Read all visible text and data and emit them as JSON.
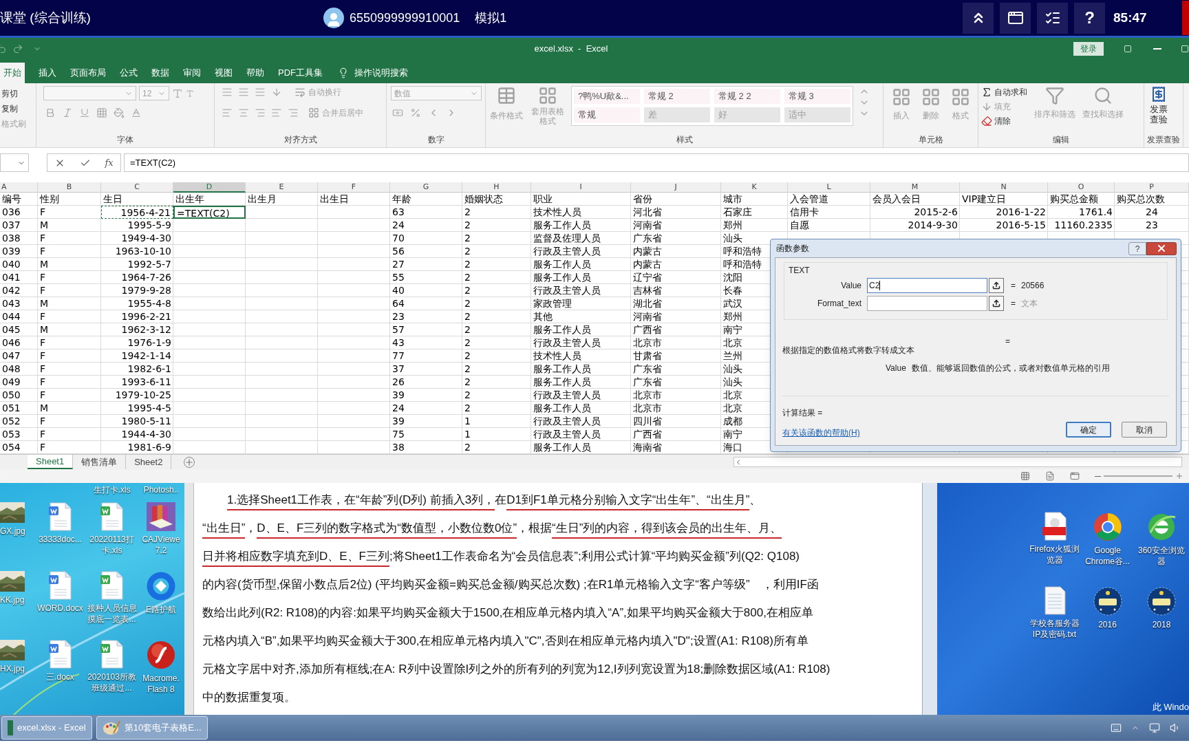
{
  "exam_bar": {
    "title": "课堂 (综合训练)",
    "user_id": "6550999999910001",
    "mode": "模拟1",
    "help": "?",
    "timer": "85:47"
  },
  "excel": {
    "title": "excel.xlsx  -  Excel",
    "login": "登录",
    "tabs": [
      {
        "label": "开始",
        "selected": true
      },
      {
        "label": "插入",
        "selected": false
      },
      {
        "label": "页面布局",
        "selected": false
      },
      {
        "label": "公式",
        "selected": false
      },
      {
        "label": "数据",
        "selected": false
      },
      {
        "label": "审阅",
        "selected": false
      },
      {
        "label": "视图",
        "selected": false
      },
      {
        "label": "帮助",
        "selected": false
      },
      {
        "label": "PDF工具集",
        "selected": false
      }
    ],
    "search_hint": "操作说明搜索",
    "ribbon": [
      {
        "kind": "clipboard",
        "items": [
          "剪切",
          "复制",
          "格式刷"
        ]
      },
      {
        "kind": "font",
        "label": "字体",
        "size": "12"
      },
      {
        "kind": "alignment",
        "label": "对齐方式",
        "wrap": "自动换行",
        "merge": "合并后居中"
      },
      {
        "kind": "number",
        "label": "数字",
        "format": "数值"
      },
      {
        "kind": "styles",
        "label": "样式",
        "conditional": "条件格式",
        "table_format": "套用表格格式",
        "styles": [
          "?鸭%U歃&...",
          "常规 2",
          "常规 2 2",
          "常规 3",
          "常规",
          "差",
          "好",
          "适中"
        ]
      },
      {
        "kind": "cells",
        "label": "单元格",
        "items": [
          "插入",
          "删除",
          "格式"
        ]
      },
      {
        "kind": "editing",
        "label": "编辑",
        "autosum": "自动求和",
        "fill": "填充",
        "clear": "清除",
        "sort": "排序和筛选",
        "find": "查找和选择"
      },
      {
        "kind": "invoice",
        "label": "发票查验",
        "button": "发票查验"
      }
    ],
    "formula_bar": {
      "fx": "fx",
      "formula": "=TEXT(C2)"
    },
    "columns": [
      {
        "letter": "A",
        "selected": false
      },
      {
        "letter": "B",
        "selected": false
      },
      {
        "letter": "C",
        "selected": false
      },
      {
        "letter": "D",
        "selected": true
      },
      {
        "letter": "E",
        "selected": false
      },
      {
        "letter": "F",
        "selected": false
      },
      {
        "letter": "G",
        "selected": false
      },
      {
        "letter": "H",
        "selected": false
      },
      {
        "letter": "I",
        "selected": false
      },
      {
        "letter": "J",
        "selected": false
      },
      {
        "letter": "K",
        "selected": false
      },
      {
        "letter": "L",
        "selected": false
      },
      {
        "letter": "M",
        "selected": false
      },
      {
        "letter": "N",
        "selected": false
      },
      {
        "letter": "O",
        "selected": false
      },
      {
        "letter": "P",
        "selected": false
      }
    ],
    "rows": [
      {
        "cells": {
          "A": "编号",
          "B": "性别",
          "C": "生日",
          "D": "出生年",
          "E": "出生月",
          "F": "出生日",
          "G": "年龄",
          "H": "婚姻状态",
          "I": "职业",
          "J": "省份",
          "K": "城市",
          "L": "入会管道",
          "M": "会员入会日",
          "N": "VIP建立日",
          "O": "购买总金额",
          "P": "购买总次数"
        }
      },
      {
        "cells": {
          "A": "036",
          "B": "F",
          "C": {
            "text": "1956-4-21",
            "referenced": true
          },
          "D": {
            "text": "=TEXT(C2)",
            "active": true
          },
          "G": "63",
          "H": "2",
          "I": "技术性人员",
          "J": "河北省",
          "K": "石家庄",
          "L": "信用卡",
          "M": "2015-2-6",
          "N": "2016-1-22",
          "O": "1761.4",
          "P": "24"
        }
      },
      {
        "cells": {
          "A": "037",
          "B": "M",
          "C": "1995-5-9",
          "G": "24",
          "H": "2",
          "I": "服务工作人员",
          "J": "河南省",
          "K": "郑州",
          "L": "自愿",
          "M": "2014-9-30",
          "N": "2016-5-15",
          "O": "11160.2335",
          "P": "23"
        }
      },
      {
        "cells": {
          "A": "038",
          "B": "F",
          "C": "1949-4-30",
          "G": "70",
          "H": "2",
          "I": "监督及佐理人员",
          "J": "广东省",
          "K": "汕头"
        }
      },
      {
        "cells": {
          "A": "039",
          "B": "F",
          "C": "1963-10-10",
          "G": "56",
          "H": "2",
          "I": "行政及主管人员",
          "J": "内蒙古",
          "K": "呼和浩特"
        }
      },
      {
        "cells": {
          "A": "040",
          "B": "M",
          "C": "1992-5-7",
          "G": "27",
          "H": "2",
          "I": "服务工作人员",
          "J": "内蒙古",
          "K": "呼和浩特"
        }
      },
      {
        "cells": {
          "A": "041",
          "B": "F",
          "C": "1964-7-26",
          "G": "55",
          "H": "2",
          "I": "服务工作人员",
          "J": "辽宁省",
          "K": "沈阳"
        }
      },
      {
        "cells": {
          "A": "042",
          "B": "F",
          "C": "1979-9-28",
          "G": "40",
          "H": "2",
          "I": "行政及主管人员",
          "J": "吉林省",
          "K": "长春"
        }
      },
      {
        "cells": {
          "A": "043",
          "B": "M",
          "C": "1955-4-8",
          "G": "64",
          "H": "2",
          "I": "家政管理",
          "J": "湖北省",
          "K": "武汉"
        }
      },
      {
        "cells": {
          "A": "044",
          "B": "F",
          "C": "1996-2-21",
          "G": "23",
          "H": "2",
          "I": "其他",
          "J": "河南省",
          "K": "郑州"
        }
      },
      {
        "cells": {
          "A": "045",
          "B": "M",
          "C": "1962-3-12",
          "G": "57",
          "H": "2",
          "I": "服务工作人员",
          "J": "广西省",
          "K": "南宁"
        }
      },
      {
        "cells": {
          "A": "046",
          "B": "F",
          "C": "1976-1-9",
          "G": "43",
          "H": "2",
          "I": "行政及主管人员",
          "J": "北京市",
          "K": "北京"
        }
      },
      {
        "cells": {
          "A": "047",
          "B": "F",
          "C": "1942-1-14",
          "G": "77",
          "H": "2",
          "I": "技术性人员",
          "J": "甘肃省",
          "K": "兰州"
        }
      },
      {
        "cells": {
          "A": "048",
          "B": "F",
          "C": "1982-6-1",
          "G": "37",
          "H": "2",
          "I": "服务工作人员",
          "J": "广东省",
          "K": "汕头"
        }
      },
      {
        "cells": {
          "A": "049",
          "B": "F",
          "C": "1993-6-11",
          "G": "26",
          "H": "2",
          "I": "服务工作人员",
          "J": "广东省",
          "K": "汕头"
        }
      },
      {
        "cells": {
          "A": "050",
          "B": "F",
          "C": "1979-10-25",
          "G": "39",
          "H": "2",
          "I": "行政及主管人员",
          "J": "北京市",
          "K": "北京"
        }
      },
      {
        "cells": {
          "A": "051",
          "B": "M",
          "C": "1995-4-5",
          "G": "24",
          "H": "2",
          "I": "服务工作人员",
          "J": "北京市",
          "K": "北京"
        }
      },
      {
        "cells": {
          "A": "052",
          "B": "F",
          "C": "1980-5-11",
          "G": "39",
          "H": "1",
          "I": "行政及主管人员",
          "J": "四川省",
          "K": "成都"
        }
      },
      {
        "cells": {
          "A": "053",
          "B": "F",
          "C": "1944-4-30",
          "G": "75",
          "H": "1",
          "I": "行政及主管人员",
          "J": "广西省",
          "K": "南宁"
        }
      },
      {
        "cells": {
          "A": "054",
          "B": "F",
          "C": "1981-6-9",
          "G": "38",
          "H": "2",
          "I": "服务工作人员",
          "J": "海南省",
          "K": "海口"
        }
      }
    ],
    "sheet_tabs": [
      {
        "label": "Sheet1",
        "selected": true
      },
      {
        "label": "销售清单",
        "selected": false
      },
      {
        "label": "Sheet2",
        "selected": false
      }
    ],
    "dialog": {
      "title": "函数参数",
      "help": "?",
      "function": "TEXT",
      "args": [
        {
          "label": "Value",
          "value": "C2",
          "eq": "=",
          "result": "20566",
          "focused": true
        },
        {
          "label": "Format_text",
          "eq": "=",
          "result": "文本",
          "focused": false
        }
      ],
      "eq": "=",
      "description": "根据指定的数值格式将数字转成文本",
      "arg_help_label": "Value",
      "arg_help": "数值、能够返回数值的公式，或者对数值单元格的引用",
      "result_label": "计算结果 =",
      "help_link": "有关该函数的帮助(H)",
      "ok": "确定",
      "cancel": "取消"
    }
  },
  "document": {
    "lines": [
      {
        "segments": [
          {
            "text": "1.选择Sheet1工作表，在“年龄”列(D列) 前插入3列，",
            "underlined": true
          },
          {
            "text": "在",
            "underlined": false
          },
          {
            "text": "D1到F1单元格分别输入文字“出生年”、“出生月”",
            "underlined": true
          },
          {
            "text": "、",
            "underlined": false
          }
        ]
      },
      {
        "segments": [
          {
            "text": "“出生日”",
            "underlined": true
          },
          {
            "text": "，",
            "underlined": false
          },
          {
            "text": "D、E、F三列的数字格式为“数值型，小数位数0位”",
            "underlined": true
          },
          {
            "text": "，根据",
            "underlined": false
          },
          {
            "text": "“生日”列的内容，得到该会员的出生年、月、",
            "underlined": true
          }
        ]
      },
      {
        "segments": [
          {
            "text": "日并将相应数字填充到D、E、F三列",
            "underlined": true
          },
          {
            "text": ";将Sheet1工作表命名为“会员信息表”;利用公式计算“平均购买金额”列(Q2: Q108)",
            "underlined": false
          }
        ]
      },
      {
        "segments": [
          {
            "text": "的内容(货币型,保留小数点后2位) (平均购买金额=购买总金额/购买总次数) ;在R1单元格输入文字“客户等级”　，利用IF函",
            "underlined": false
          }
        ]
      },
      {
        "segments": [
          {
            "text": "数给出此列(R2: R108)的内容:如果平均购买金额大于1500,在相应单元格内填入“A”,如果平均购买金额大于800,在相应单",
            "underlined": false
          }
        ]
      },
      {
        "segments": [
          {
            "text": "元格内填入“B”,如果平均购买金额大于300,在相应单元格内填入\"C\",否则在相应单元格内填入\"D\";设置(A1: R108)所有单",
            "underlined": false
          }
        ]
      },
      {
        "segments": [
          {
            "text": "元格文字居中对齐,添加所有框线;在A: R列中设置除I列之外的所有列的列宽为12,I列列宽设置为18;删除数据区域(A1: R108)",
            "underlined": false
          }
        ]
      },
      {
        "segments": [
          {
            "text": "中的数据重复项。",
            "underlined": false
          }
        ]
      }
    ]
  },
  "desktop": {
    "left_top_labels": [
      "生打卡.xls",
      "Photosh.."
    ],
    "left_icons": [
      {
        "label": "GX.jpg"
      },
      {
        "kind": "word",
        "label": "33333doc..."
      },
      {
        "kind": "sheet",
        "label": "20220113打卡.xls"
      },
      {
        "kind": "books",
        "label": "CAJViewe 7.2"
      },
      {
        "label": "KK.jpg"
      },
      {
        "kind": "word",
        "label": "WORD.docx"
      },
      {
        "kind": "sheet",
        "label": "接种人员信息摸底一览表..."
      },
      {
        "kind": "ring",
        "label": "E路护航"
      },
      {
        "label": "HX.jpg"
      },
      {
        "kind": "word",
        "label": "三.docx"
      },
      {
        "kind": "sheet",
        "label": "2020103所教班级通过..."
      },
      {
        "kind": "flash",
        "label": "Macrome. Flash 8"
      }
    ],
    "right_icons": [
      {
        "kind": "pdf",
        "label": "Firefox火狐浏览器"
      },
      {
        "kind": "chrome",
        "label": "Google Chrome谷..."
      },
      {
        "kind": "browser360",
        "label": "360安全浏览器"
      },
      {
        "kind": "text",
        "label": "学校各服务器IP及密码.txt"
      },
      {
        "kind": "badge",
        "label": "2016"
      },
      {
        "kind": "badge",
        "label": "2018"
      }
    ],
    "notice": "此 Windo"
  },
  "taskbar": {
    "buttons": [
      {
        "kind": "excel",
        "label": "excel.xlsx - Excel"
      },
      {
        "kind": "paint",
        "label": "第10套电子表格E..."
      }
    ]
  }
}
